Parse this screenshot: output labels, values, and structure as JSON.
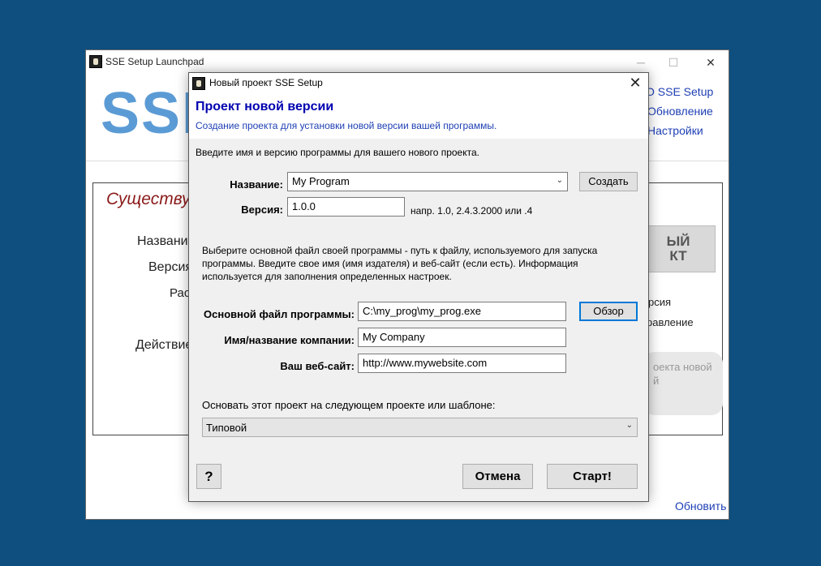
{
  "background_window": {
    "title": "SSE Setup Launchpad",
    "logo": "SSE",
    "links": [
      "О SSE Setup",
      "Обновление",
      "Настройки"
    ],
    "existing_heading": "Существу",
    "labels": [
      "Название",
      "Версия",
      "Рас",
      "Действие"
    ],
    "grey_button": "ЫЙ\nКТ",
    "right_texts": [
      "рсия",
      "равление"
    ],
    "rounded_text": "оекта новой\nй",
    "update_link": "Обновить",
    "controls": [
      "─",
      "☐",
      "✕"
    ]
  },
  "dialog": {
    "title": "Новый проект SSE Setup",
    "heading": "Проект новой версии",
    "subheading": "Создание проекта для установки новой версии вашей программы.",
    "intro": "Введите имя и версию программы для вашего нового проекта.",
    "name_label": "Название:",
    "name_value": "My Program",
    "create_button": "Создать",
    "version_label": "Версия:",
    "version_value": "1.0.0",
    "version_hint": "напр. 1.0, 2.4.3.2000 или .4",
    "desc": "Выберите основной файл своей программы - путь к файлу, используемого для запуска программы. Введите свое имя (имя издателя) и веб-сайт (если есть). Информация используется для заполнения определенных настроек.",
    "mainfile_label": "Основной файл программы:",
    "mainfile_value": "C:\\my_prog\\my_prog.exe",
    "browse_button": "Обзор",
    "company_label": "Имя/название компании:",
    "company_value": "My Company",
    "website_label": "Ваш веб-сайт:",
    "website_value": "http://www.mywebsite.com",
    "template_label": "Основать этот проект на следующем проекте или шаблоне:",
    "template_value": "Типовой",
    "help_button": "?",
    "cancel_button": "Отмена",
    "start_button": "Старт!"
  }
}
